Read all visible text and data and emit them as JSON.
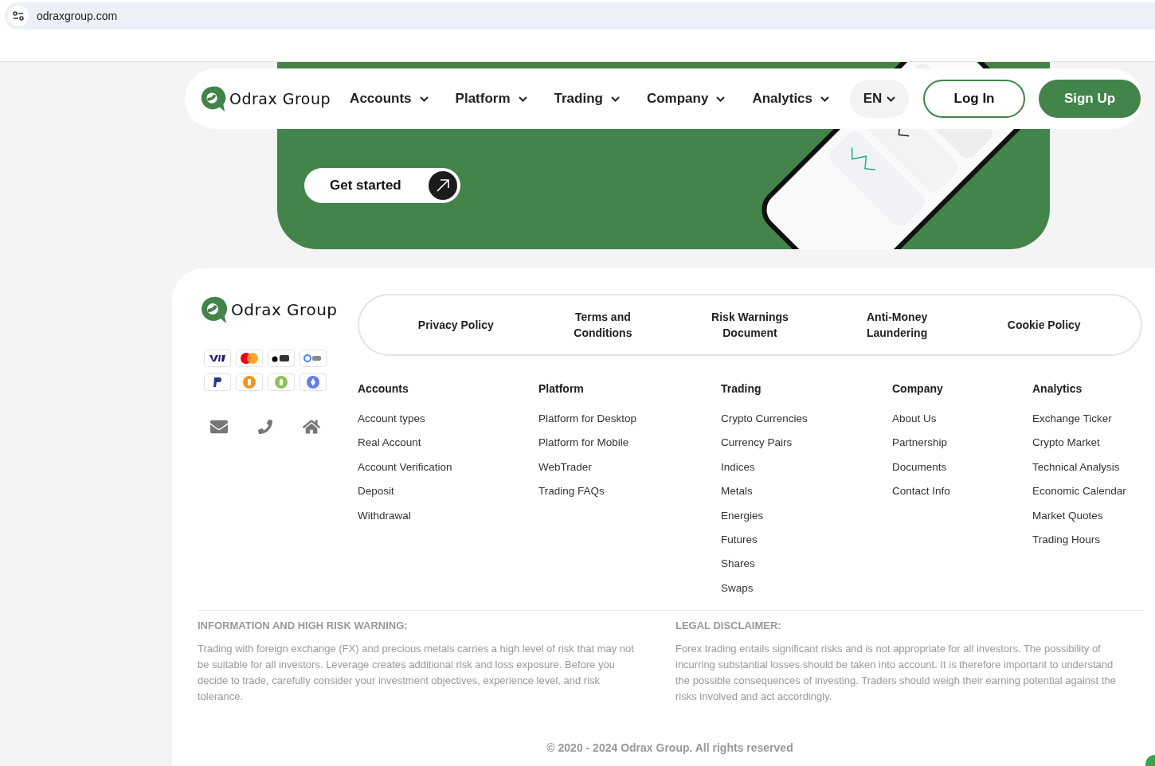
{
  "browser": {
    "url": "odraxgroup.com"
  },
  "nav": {
    "brand": "Odrax Group",
    "menu": [
      {
        "label": "Accounts"
      },
      {
        "label": "Platform"
      },
      {
        "label": "Trading"
      },
      {
        "label": "Company"
      },
      {
        "label": "Analytics"
      }
    ],
    "language": "EN",
    "login": "Log In",
    "signup": "Sign Up"
  },
  "hero": {
    "cta": "Get started"
  },
  "footer": {
    "brand": "Odrax Group",
    "policies": [
      "Privacy Policy",
      "Terms and Conditions",
      "Risk Warnings Document",
      "Anti-Money Laundering",
      "Cookie Policy"
    ],
    "columns": [
      {
        "title": "Accounts",
        "links": [
          "Account types",
          "Real Account",
          "Account Verification",
          "Deposit",
          "Withdrawal"
        ]
      },
      {
        "title": "Platform",
        "links": [
          "Platform for Desktop",
          "Platform for Mobile",
          "WebTrader",
          "Trading FAQs"
        ]
      },
      {
        "title": "Trading",
        "links": [
          "Crypto Currencies",
          "Currency Pairs",
          "Indices",
          "Metals",
          "Energies",
          "Futures",
          "Shares",
          "Swaps"
        ]
      },
      {
        "title": "Company",
        "links": [
          "About Us",
          "Partnership",
          "Documents",
          "Contact Info"
        ]
      },
      {
        "title": "Analytics",
        "links": [
          "Exchange Ticker",
          "Crypto Market",
          "Technical Analysis",
          "Economic Calendar",
          "Market Quotes",
          "Trading Hours"
        ]
      }
    ],
    "warnings": [
      {
        "title": "INFORMATION AND HIGH RISK WARNING:",
        "text": "Trading with foreign exchange (FX) and precious metals carries a high level of risk that may not be suitable for all investors. Leverage creates additional risk and loss exposure. Before you decide to trade, carefully consider your investment objectives, experience level, and risk tolerance."
      },
      {
        "title": "LEGAL DISCLAIMER:",
        "text": "Forex trading entails significant risks and is not appropriate for all investors. The possibility of incurring substantial losses should be taken into account. It is therefore important to understand the possible consequences of investing. Traders should weigh their earning potential against the risks involved and act accordingly."
      }
    ],
    "copyright": "© 2020 - 2024 Odrax Group. All rights reserved"
  }
}
